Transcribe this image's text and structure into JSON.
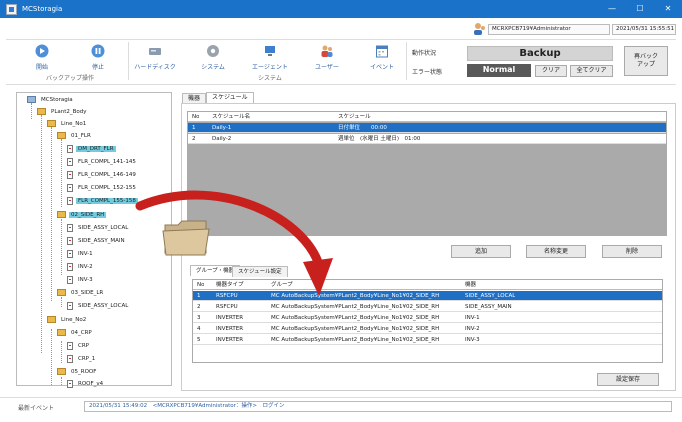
{
  "window": {
    "title": "MCStoragia",
    "controls": {
      "minimize": "—",
      "maximize": "☐",
      "close": "✕"
    }
  },
  "infobar": {
    "user": "MCRXPCB719¥Administrator",
    "date": "2021/05/31 15:55:51"
  },
  "toolbar": {
    "start_label": "開始",
    "stop_label": "停止",
    "backup_group": "バックアップ操作",
    "harddisk_label": "ハードディスク",
    "system_label": "システム",
    "agent_label": "エージェント",
    "user_label": "ユーザー",
    "event_label": "イベント",
    "system_group": "システム"
  },
  "status": {
    "run_state_label": "動作状況",
    "error_state_label": "エラー状態",
    "backup_value": "Backup",
    "normal_value": "Normal",
    "clear_button": "クリア",
    "clear_all_button": "全てクリア",
    "rebackup_button_line1": "再バック",
    "rebackup_button_line2": "アップ"
  },
  "tree": {
    "nodes": [
      {
        "label": "MCStoragia",
        "type": "root"
      },
      {
        "label": "PLant2_Body",
        "type": "folder"
      },
      {
        "label": "Line_No1",
        "type": "folder"
      },
      {
        "label": "01_FLR",
        "type": "folder"
      },
      {
        "label": "DM_DRT_FLR",
        "type": "doc"
      },
      {
        "label": "FLR_COMPL_141-145",
        "type": "doc"
      },
      {
        "label": "FLR_COMPL_146-149",
        "type": "doc"
      },
      {
        "label": "FLR_COMPL_152-155",
        "type": "doc"
      },
      {
        "label": "FLR_COMPL_155-158",
        "type": "doc"
      },
      {
        "label": "02_SIDE_RH",
        "type": "folder"
      },
      {
        "label": "SIDE_ASSY_LOCAL",
        "type": "doc"
      },
      {
        "label": "SIDE_ASSY_MAIN",
        "type": "doc"
      },
      {
        "label": "INV-1",
        "type": "doc"
      },
      {
        "label": "INV-2",
        "type": "doc"
      },
      {
        "label": "INV-3",
        "type": "doc"
      },
      {
        "label": "03_SIDE_LR",
        "type": "folder"
      },
      {
        "label": "SIDE_ASSY_LOCAL",
        "type": "doc"
      },
      {
        "label": "Line_No2",
        "type": "folder"
      },
      {
        "label": "04_CRP",
        "type": "folder"
      },
      {
        "label": "CRP",
        "type": "doc"
      },
      {
        "label": "CRP_1",
        "type": "doc"
      },
      {
        "label": "05_ROOF",
        "type": "folder"
      },
      {
        "label": "ROOF_v4",
        "type": "doc"
      }
    ]
  },
  "tabs_top": [
    "機器",
    "スケジュール"
  ],
  "schedule": {
    "headers": [
      "No",
      "スケジュール名",
      "スケジュール"
    ],
    "rows": [
      [
        "1",
        "Daily-1",
        "日付単位　　00:00"
      ],
      [
        "2",
        "Daily-2",
        "週単位　(水曜日 土曜日)　01:00"
      ]
    ]
  },
  "schedule_buttons": {
    "add": "追加",
    "rename": "名称変更",
    "delete": "削除"
  },
  "tabs_bottom": [
    "グループ・機器",
    "スケジュール設定"
  ],
  "devices": {
    "headers": [
      "No",
      "機器タイプ",
      "グループ",
      "機器"
    ],
    "rows": [
      [
        "1",
        "RSFCPU",
        "MC AutoBackupSystem¥PLant2_Body¥Line_No1¥02_SIDE_RH",
        "SIDE_ASSY_LOCAL"
      ],
      [
        "2",
        "RSFCPU",
        "MC AutoBackupSystem¥PLant2_Body¥Line_No1¥02_SIDE_RH",
        "SIDE_ASSY_MAIN"
      ],
      [
        "3",
        "INVERTER",
        "MC AutoBackupSystem¥PLant2_Body¥Line_No1¥02_SIDE_RH",
        "INV-1"
      ],
      [
        "4",
        "INVERTER",
        "MC AutoBackupSystem¥PLant2_Body¥Line_No1¥02_SIDE_RH",
        "INV-2"
      ],
      [
        "5",
        "INVERTER",
        "MC AutoBackupSystem¥PLant2_Body¥Line_No1¥02_SIDE_RH",
        "INV-3"
      ]
    ]
  },
  "save_button": "設定保存",
  "statusbar": {
    "label": "最新イベント",
    "log": "2021/05/31 15:49:02　<MCRXPCB719¥Administrator：操作>　ログイン"
  },
  "colors": {
    "titlebar": "#1a73c9",
    "selection": "#1f6fc4",
    "tree_highlight": "#74cbe0",
    "arrow": "#c8201c"
  }
}
